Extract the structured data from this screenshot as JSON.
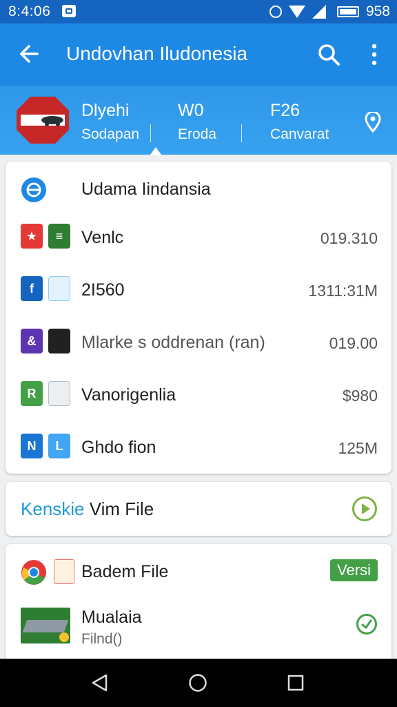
{
  "status_bar": {
    "time": "8:4:06",
    "battery_text": "958"
  },
  "app_bar": {
    "title": "Undovhan Iludonesia",
    "icons": [
      "back-arrow-icon",
      "search-icon",
      "more-vert-icon"
    ]
  },
  "header": {
    "stats": [
      {
        "value": "Dlyehi",
        "label": "Sodapan"
      },
      {
        "value": "W0",
        "label": "Eroda"
      },
      {
        "value": "F26",
        "label": "Canvarat"
      }
    ]
  },
  "list_card": {
    "heading": "Udama Iindansia",
    "items": [
      {
        "name": "Venlc",
        "value": "019.310"
      },
      {
        "name": "2I560",
        "value": "1311:31M"
      },
      {
        "name": "Mlarke s oddrenan (ran)",
        "value": "019.00"
      },
      {
        "name": "Vanorigenlia",
        "value": "$980"
      },
      {
        "name": "Ghdo fion",
        "value": "125M"
      }
    ]
  },
  "file_card": {
    "label_prefix": "Kenskie",
    "label_rest": " Vim File"
  },
  "bottom_card": {
    "items": [
      {
        "name": "Badem File",
        "badge": "Versi"
      },
      {
        "name": "Mualaia",
        "sub": "Filnd()"
      }
    ]
  },
  "colors": {
    "status_bar": "#1565c0",
    "app_bar": "#1e88e5",
    "header": "#37a2f0",
    "accent_green": "#43a047",
    "accent_blue": "#1f9ad6"
  }
}
